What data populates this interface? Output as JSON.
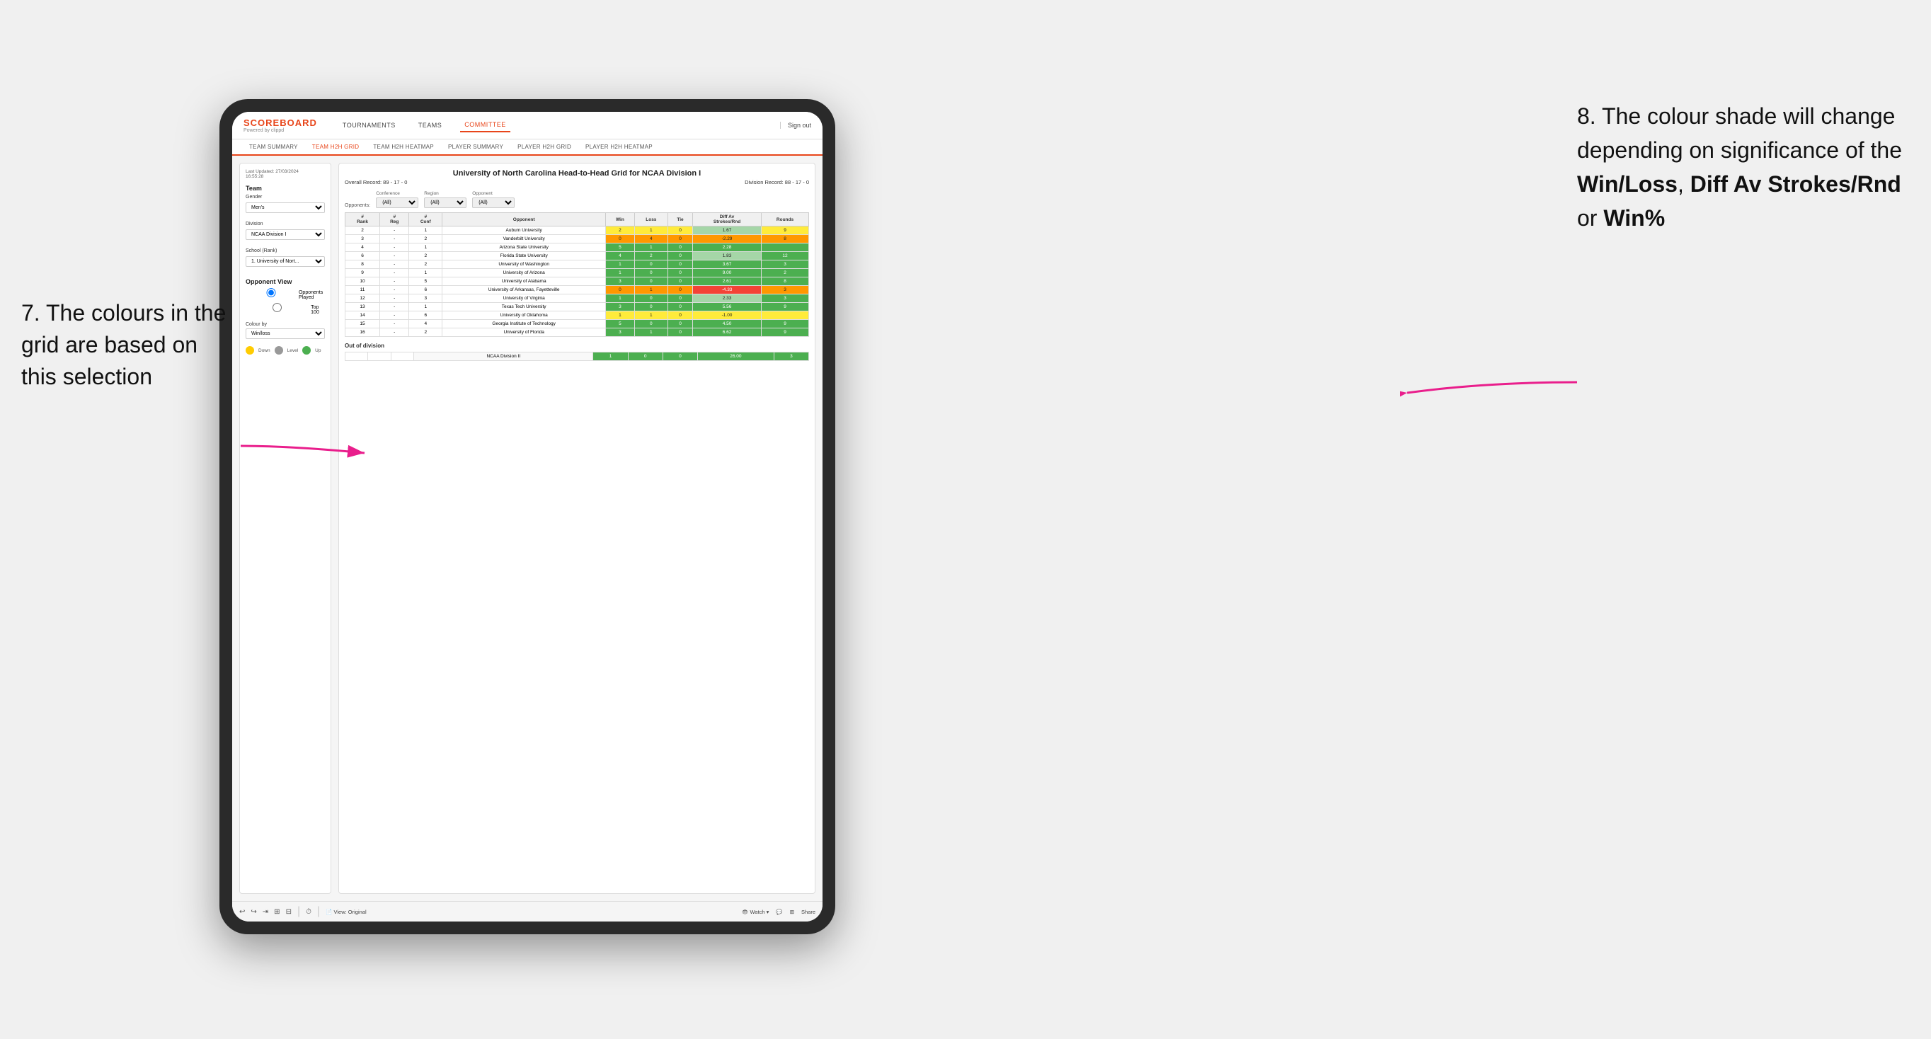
{
  "annotations": {
    "left": {
      "text": "7. The colours in the grid are based on this selection"
    },
    "right": {
      "text_before": "8. The colour shade will change depending on significance of the ",
      "bold1": "Win/Loss",
      "text_mid1": ", ",
      "bold2": "Diff Av Strokes/Rnd",
      "text_mid2": " or ",
      "bold3": "Win%"
    }
  },
  "app": {
    "logo": "SCOREBOARD",
    "logo_sub": "Powered by clippd",
    "nav": [
      "TOURNAMENTS",
      "TEAMS",
      "COMMITTEE"
    ],
    "sign_out": "Sign out"
  },
  "sub_nav": {
    "items": [
      "TEAM SUMMARY",
      "TEAM H2H GRID",
      "TEAM H2H HEATMAP",
      "PLAYER SUMMARY",
      "PLAYER H2H GRID",
      "PLAYER H2H HEATMAP"
    ],
    "active": "TEAM H2H GRID"
  },
  "left_panel": {
    "timestamp": "Last Updated: 27/03/2024\n16:55:28",
    "team_label": "Team",
    "gender_label": "Gender",
    "gender_value": "Men's",
    "division_label": "Division",
    "division_value": "NCAA Division I",
    "school_label": "School (Rank)",
    "school_value": "1. University of Nort...",
    "opponent_view_label": "Opponent View",
    "radio_opponents": "Opponents Played",
    "radio_top": "Top 100",
    "colour_by_label": "Colour by",
    "colour_by_value": "Win/loss",
    "legend": {
      "down": "Down",
      "level": "Level",
      "up": "Up"
    }
  },
  "grid": {
    "title": "University of North Carolina Head-to-Head Grid for NCAA Division I",
    "overall_record": "Overall Record: 89 - 17 - 0",
    "division_record": "Division Record: 88 - 17 - 0",
    "filters": {
      "opponents_label": "Opponents:",
      "conference_label": "Conference",
      "conference_value": "(All)",
      "region_label": "Region",
      "region_value": "(All)",
      "opponent_label": "Opponent",
      "opponent_value": "(All)"
    },
    "columns": [
      "#\nRank",
      "#\nReg",
      "#\nConf",
      "Opponent",
      "Win",
      "Loss",
      "Tie",
      "Diff Av\nStrokes/Rnd",
      "Rounds"
    ],
    "rows": [
      {
        "rank": "2",
        "reg": "-",
        "conf": "1",
        "opponent": "Auburn University",
        "win": "2",
        "loss": "1",
        "tie": "0",
        "diff": "1.67",
        "rounds": "9",
        "win_color": "yellow",
        "diff_color": "light-green"
      },
      {
        "rank": "3",
        "reg": "-",
        "conf": "2",
        "opponent": "Vanderbilt University",
        "win": "0",
        "loss": "4",
        "tie": "0",
        "diff": "-2.29",
        "rounds": "8",
        "win_color": "orange",
        "diff_color": "orange"
      },
      {
        "rank": "4",
        "reg": "-",
        "conf": "1",
        "opponent": "Arizona State University",
        "win": "5",
        "loss": "1",
        "tie": "0",
        "diff": "2.28",
        "rounds": "",
        "win_color": "green",
        "diff_color": "green"
      },
      {
        "rank": "6",
        "reg": "-",
        "conf": "2",
        "opponent": "Florida State University",
        "win": "4",
        "loss": "2",
        "tie": "0",
        "diff": "1.83",
        "rounds": "12",
        "win_color": "green",
        "diff_color": "light-green"
      },
      {
        "rank": "8",
        "reg": "-",
        "conf": "2",
        "opponent": "University of Washington",
        "win": "1",
        "loss": "0",
        "tie": "0",
        "diff": "3.67",
        "rounds": "3",
        "win_color": "green",
        "diff_color": "green"
      },
      {
        "rank": "9",
        "reg": "-",
        "conf": "1",
        "opponent": "University of Arizona",
        "win": "1",
        "loss": "0",
        "tie": "0",
        "diff": "9.00",
        "rounds": "2",
        "win_color": "green",
        "diff_color": "green"
      },
      {
        "rank": "10",
        "reg": "-",
        "conf": "5",
        "opponent": "University of Alabama",
        "win": "3",
        "loss": "0",
        "tie": "0",
        "diff": "2.61",
        "rounds": "8",
        "win_color": "green",
        "diff_color": "green"
      },
      {
        "rank": "11",
        "reg": "-",
        "conf": "6",
        "opponent": "University of Arkansas, Fayetteville",
        "win": "0",
        "loss": "1",
        "tie": "0",
        "diff": "-4.33",
        "rounds": "3",
        "win_color": "orange",
        "diff_color": "red"
      },
      {
        "rank": "12",
        "reg": "-",
        "conf": "3",
        "opponent": "University of Virginia",
        "win": "1",
        "loss": "0",
        "tie": "0",
        "diff": "2.33",
        "rounds": "3",
        "win_color": "green",
        "diff_color": "light-green"
      },
      {
        "rank": "13",
        "reg": "-",
        "conf": "1",
        "opponent": "Texas Tech University",
        "win": "3",
        "loss": "0",
        "tie": "0",
        "diff": "5.56",
        "rounds": "9",
        "win_color": "green",
        "diff_color": "green"
      },
      {
        "rank": "14",
        "reg": "-",
        "conf": "6",
        "opponent": "University of Oklahoma",
        "win": "1",
        "loss": "1",
        "tie": "0",
        "diff": "-1.00",
        "rounds": "",
        "win_color": "yellow",
        "diff_color": "yellow"
      },
      {
        "rank": "15",
        "reg": "-",
        "conf": "4",
        "opponent": "Georgia Institute of Technology",
        "win": "5",
        "loss": "0",
        "tie": "0",
        "diff": "4.50",
        "rounds": "9",
        "win_color": "green",
        "diff_color": "green"
      },
      {
        "rank": "16",
        "reg": "-",
        "conf": "2",
        "opponent": "University of Florida",
        "win": "3",
        "loss": "1",
        "tie": "0",
        "diff": "6.62",
        "rounds": "9",
        "win_color": "green",
        "diff_color": "green"
      }
    ],
    "out_of_division": {
      "label": "Out of division",
      "rows": [
        {
          "opponent": "NCAA Division II",
          "win": "1",
          "loss": "0",
          "tie": "0",
          "diff": "26.00",
          "rounds": "3"
        }
      ]
    }
  },
  "toolbar": {
    "view_label": "View: Original",
    "watch": "Watch",
    "share": "Share"
  }
}
